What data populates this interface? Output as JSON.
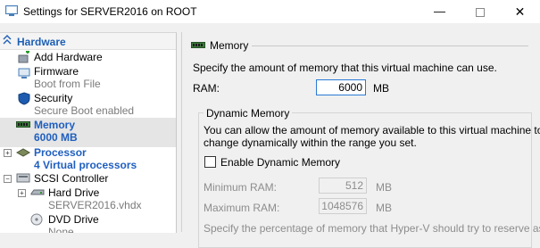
{
  "window": {
    "title": "Settings for SERVER2016 on ROOT",
    "minimize_glyph": "—",
    "close_glyph": "✕"
  },
  "tree": {
    "hardware_header": "Hardware",
    "items": [
      {
        "label": "Add Hardware",
        "sub": ""
      },
      {
        "label": "Firmware",
        "sub": "Boot from File"
      },
      {
        "label": "Security",
        "sub": "Secure Boot enabled"
      },
      {
        "label": "Memory",
        "sub": "6000 MB"
      },
      {
        "label": "Processor",
        "sub": "4 Virtual processors"
      },
      {
        "label": "SCSI Controller",
        "sub": ""
      },
      {
        "label": "Hard Drive",
        "sub": "SERVER2016.vhdx"
      },
      {
        "label": "DVD Drive",
        "sub": "None"
      }
    ]
  },
  "memory": {
    "section_title": "Memory",
    "description": "Specify the amount of memory that this virtual machine can use.",
    "ram_label": "RAM:",
    "ram_value": "6000",
    "ram_unit": "MB",
    "dynamic": {
      "title": "Dynamic Memory",
      "description_line1": "You can allow the amount of memory available to this virtual machine to",
      "description_line2": "change dynamically within the range you set.",
      "checkbox_label": "Enable Dynamic Memory",
      "checkbox_checked": false,
      "min_label": "Minimum RAM:",
      "min_value": "512",
      "min_unit": "MB",
      "max_label": "Maximum RAM:",
      "max_value": "1048576",
      "max_unit": "MB",
      "buffer_text": "Specify the percentage of memory that Hyper-V should try to reserve as a"
    }
  },
  "colors": {
    "accent": "#1f5fbf",
    "selection": "#e5e5e5",
    "focus_border": "#2a7ad5"
  }
}
